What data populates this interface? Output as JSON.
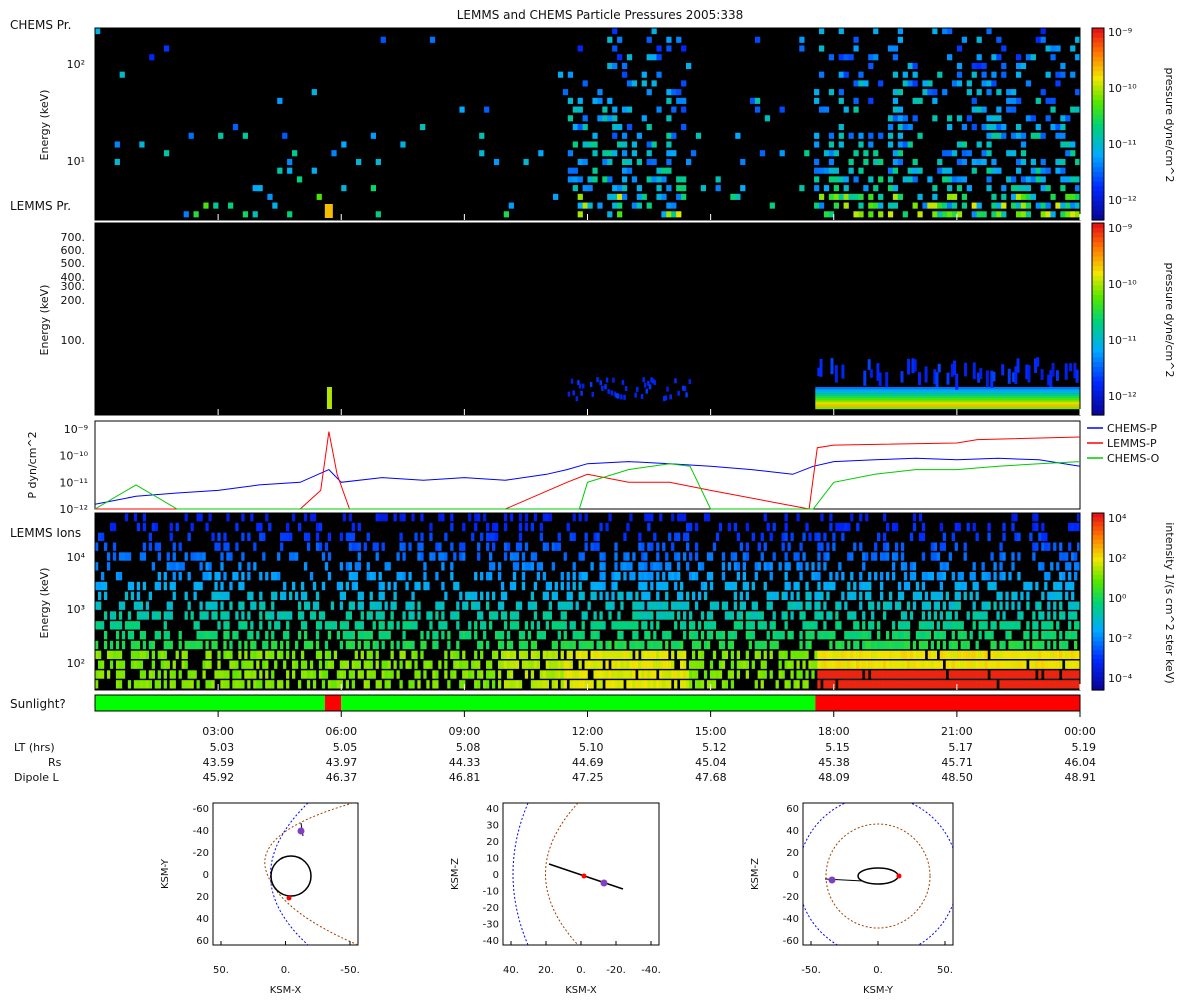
{
  "title": "LEMMS and CHEMS Particle Pressures  2005:338",
  "panel_labels": {
    "chems": "CHEMS Pr.",
    "lemms_pr": "LEMMS Pr.",
    "lemms_ions": "LEMMS Ions",
    "sunlight": "Sunlight?"
  },
  "colors": {
    "chems_p": "#0000ff",
    "lemms_p": "#ff0000",
    "chems_o": "#00cc00",
    "sunlit": "#00ff00",
    "shadow": "#ff0000"
  },
  "time_axis": {
    "ticks": [
      "03:00",
      "06:00",
      "09:00",
      "12:00",
      "15:00",
      "18:00",
      "21:00",
      "00:00"
    ],
    "rows": [
      {
        "label": "LT (hrs)",
        "values": [
          "5.03",
          "5.05",
          "5.08",
          "5.10",
          "5.12",
          "5.15",
          "5.17",
          "5.19"
        ]
      },
      {
        "label": "Rs",
        "values": [
          "43.59",
          "43.97",
          "44.33",
          "44.69",
          "45.04",
          "45.38",
          "45.71",
          "46.04"
        ]
      },
      {
        "label": "Dipole L",
        "values": [
          "45.92",
          "46.37",
          "46.81",
          "47.25",
          "47.68",
          "48.09",
          "48.50",
          "48.91"
        ]
      }
    ]
  },
  "chart_data": [
    {
      "type": "heatmap",
      "name": "CHEMS Pr.",
      "ylabel": "Energy (keV)",
      "yticks": [
        "10¹",
        "10²"
      ],
      "colorbar": {
        "label": "pressure dyne/cm^2",
        "ticks": [
          "10⁻⁹",
          "10⁻¹⁰",
          "10⁻¹¹",
          "10⁻¹²"
        ]
      }
    },
    {
      "type": "heatmap",
      "name": "LEMMS Pr.",
      "ylabel": "Energy (keV)",
      "yticks": [
        "700.",
        "600.",
        "500.",
        "400.",
        "300.",
        "200.",
        "100."
      ],
      "colorbar": {
        "label": "pressure dyne/cm^2",
        "ticks": [
          "10⁻⁹",
          "10⁻¹⁰",
          "10⁻¹¹",
          "10⁻¹²"
        ]
      }
    },
    {
      "type": "line",
      "ylabel": "P dyn/cm^2",
      "yscale": "log",
      "ylim": [
        1e-12,
        2e-09
      ],
      "yticks": [
        "10⁻⁹",
        "10⁻¹⁰",
        "10⁻¹¹",
        "10⁻¹²"
      ],
      "xlim": [
        0,
        24
      ],
      "series": [
        {
          "name": "CHEMS-P",
          "x": [
            0,
            1,
            2,
            3,
            4,
            5,
            5.7,
            6,
            7,
            8,
            9,
            10,
            11,
            11.5,
            12,
            13,
            14,
            15,
            16,
            17,
            17.5,
            18,
            19,
            20,
            21,
            22,
            23,
            24
          ],
          "y": [
            1.5e-12,
            3e-12,
            4e-12,
            5e-12,
            8e-12,
            1e-11,
            3e-11,
            1e-11,
            1.5e-11,
            1.2e-11,
            1.5e-11,
            1.2e-11,
            2e-11,
            3e-11,
            5e-11,
            6e-11,
            5e-11,
            4e-11,
            3e-11,
            2e-11,
            4e-11,
            6e-11,
            7e-11,
            8e-11,
            7e-11,
            8e-11,
            7e-11,
            4e-11
          ]
        },
        {
          "name": "LEMMS-P",
          "x": [
            0,
            5,
            5.5,
            5.7,
            5.9,
            6.2,
            10,
            11.5,
            12,
            13,
            14,
            15,
            17.4,
            17.6,
            18,
            21,
            21.5,
            24
          ],
          "y": [
            1e-12,
            1e-12,
            5e-12,
            8e-10,
            2e-11,
            1e-12,
            1e-12,
            1e-11,
            2e-11,
            1e-11,
            1e-11,
            5e-12,
            1e-12,
            2e-10,
            2.5e-10,
            3e-10,
            4e-10,
            5e-10
          ]
        },
        {
          "name": "CHEMS-O",
          "x": [
            0,
            1,
            2,
            4,
            6,
            8,
            10,
            11.8,
            12,
            13,
            14,
            14.5,
            15,
            17.5,
            18,
            19,
            20,
            21,
            22,
            23,
            24
          ],
          "y": [
            1e-12,
            8e-12,
            1e-12,
            1e-12,
            1e-12,
            1e-12,
            1e-12,
            1e-12,
            1e-11,
            3e-11,
            5e-11,
            4e-11,
            1e-12,
            1e-12,
            1e-11,
            2e-11,
            3e-11,
            3e-11,
            4e-11,
            5e-11,
            6e-11
          ]
        }
      ]
    },
    {
      "type": "heatmap",
      "name": "LEMMS Ions",
      "ylabel": "Energy (keV)",
      "yticks": [
        "10²",
        "10³",
        "10⁴"
      ],
      "colorbar": {
        "label": "intensity 1/(s cm^2 ster keV)",
        "ticks": [
          "10⁴",
          "10²",
          "10⁰",
          "10⁻²",
          "10⁻⁴"
        ]
      }
    },
    {
      "type": "bar",
      "name": "Sunlight?",
      "segments": [
        {
          "start": 0,
          "end": 5.6,
          "state": "sunlit"
        },
        {
          "start": 5.6,
          "end": 6.0,
          "state": "shadow"
        },
        {
          "start": 6.0,
          "end": 17.55,
          "state": "sunlit"
        },
        {
          "start": 17.55,
          "end": 24,
          "state": "shadow"
        }
      ]
    }
  ],
  "orbit_plots": [
    {
      "xlabel": "KSM-X",
      "ylabel": "KSM-Y",
      "xticks": [
        "50.",
        "0.",
        "-50."
      ],
      "yticks": [
        "-60",
        "-40",
        "-20",
        "0",
        "20",
        "40",
        "60"
      ]
    },
    {
      "xlabel": "KSM-X",
      "ylabel": "KSM-Z",
      "xticks": [
        "40.",
        "20.",
        "0.",
        "-20.",
        "-40."
      ],
      "yticks": [
        "40",
        "30",
        "20",
        "10",
        "0",
        "-10",
        "-20",
        "-30",
        "-40"
      ]
    },
    {
      "xlabel": "KSM-Y",
      "ylabel": "KSM-Z",
      "xticks": [
        "-50.",
        "0.",
        "50."
      ],
      "yticks": [
        "60",
        "40",
        "20",
        "0",
        "-20",
        "-40",
        "-60"
      ]
    }
  ]
}
